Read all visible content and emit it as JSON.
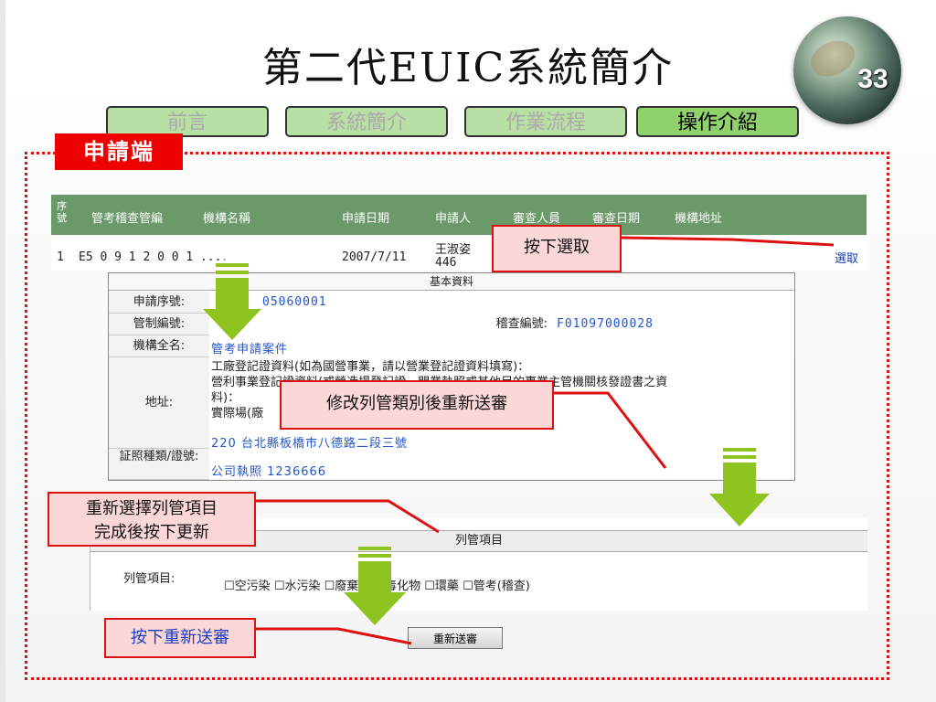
{
  "slide": {
    "title": "第二代EUIC系統簡介",
    "number": "33",
    "tabs": [
      {
        "label": "前言"
      },
      {
        "label": "系統簡介"
      },
      {
        "label": "作業流程"
      },
      {
        "label": "操作介紹"
      }
    ],
    "section_badge": "申請端"
  },
  "result_table": {
    "headers": [
      "序號",
      "管考稽查管編",
      "機構名稱",
      "申請日期",
      "申請人",
      "審查人員",
      "審查日期",
      "機構地址"
    ],
    "row": {
      "seq": "1",
      "code": "E5 0 9 1 2 0 0 1 ...",
      "org": "...",
      "date": "2007/7/11",
      "applicant": "王淑姿",
      "applicant_extra": "446",
      "select": "選取"
    }
  },
  "basic_info": {
    "title": "基本資料",
    "apply_seq_label": "申請序號:",
    "apply_seq_value": "05060001",
    "control_no_label": "管制編號:",
    "audit_no_label": "稽查編號:",
    "audit_no_value": "F01097000028",
    "org_name_label": "機構全名:",
    "org_name_value": "管考申請案件",
    "address_label": "地址:",
    "address_line1": "工廠登記證資料(如為國營事業，請以營業登記證資料填寫)：",
    "address_line2": "營利事業登記證資料(或營造場登記證、開業執照或其他目的事業主管機關核發證書之資",
    "address_line3": "料)：",
    "address_line4": "實際場(廠",
    "address_value": "220 台北縣板橋市八德路二段三號",
    "license_label": "証照種類/證號:",
    "license_value": "公司執照 1236666"
  },
  "control_items": {
    "title": "列管項目",
    "label": "列管項目:",
    "options": [
      {
        "label": "空污染"
      },
      {
        "label": "水污染"
      },
      {
        "label": "廢棄物"
      },
      {
        "label": "毒化物"
      },
      {
        "label": "環藥"
      },
      {
        "label": "管考(稽查)"
      }
    ]
  },
  "buttons": {
    "resend": "重新送審"
  },
  "callouts": {
    "select": "按下選取",
    "modify": "修改列管類別後重新送審",
    "reselect_line1": "重新選擇列管項目",
    "reselect_line2": "完成後按下更新",
    "resend": "按下重新送審"
  },
  "colors": {
    "accent_red": "#dd1111",
    "tab_green": "#8fd16a",
    "header_green": "#6a9a6a",
    "arrow_green": "#8fc31f"
  }
}
